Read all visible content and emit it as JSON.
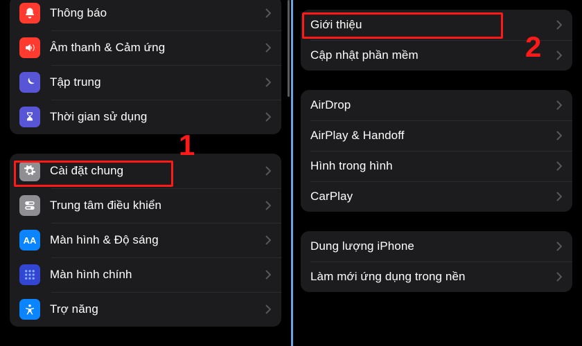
{
  "colors": {
    "ic_red": "#ff3b30",
    "ic_moon": "#5856d6",
    "ic_hourglass": "#5856d6",
    "ic_gear": "#8e8e93",
    "ic_toggles": "#8e8e93",
    "ic_aa": "#0a84ff",
    "ic_grid": "#3346d3",
    "ic_access": "#0a84ff"
  },
  "left": {
    "group1": [
      {
        "label": "Thông báo",
        "icon": "bell",
        "bg": "ic_red"
      },
      {
        "label": "Âm thanh & Cảm ứng",
        "icon": "speaker",
        "bg": "ic_red"
      },
      {
        "label": "Tập trung",
        "icon": "moon",
        "bg": "ic_moon"
      },
      {
        "label": "Thời gian sử dụng",
        "icon": "hourglass",
        "bg": "ic_hourglass"
      }
    ],
    "group2": [
      {
        "label": "Cài đặt chung",
        "icon": "gear",
        "bg": "ic_gear"
      },
      {
        "label": "Trung tâm điều khiển",
        "icon": "toggles",
        "bg": "ic_toggles"
      },
      {
        "label": "Màn hình & Độ sáng",
        "icon": "aa",
        "bg": "ic_aa"
      },
      {
        "label": "Màn hình chính",
        "icon": "grid",
        "bg": "ic_grid"
      },
      {
        "label": "Trợ năng",
        "icon": "access",
        "bg": "ic_access"
      }
    ]
  },
  "right": {
    "group1": [
      {
        "label": "Giới thiệu"
      },
      {
        "label": "Cập nhật phần mềm"
      }
    ],
    "group2": [
      {
        "label": "AirDrop"
      },
      {
        "label": "AirPlay & Handoff"
      },
      {
        "label": "Hình trong hình"
      },
      {
        "label": "CarPlay"
      }
    ],
    "group3": [
      {
        "label": "Dung lượng iPhone"
      },
      {
        "label": "Làm mới ứng dụng trong nền"
      }
    ]
  },
  "annotations": {
    "n1": "1",
    "n2": "2"
  }
}
